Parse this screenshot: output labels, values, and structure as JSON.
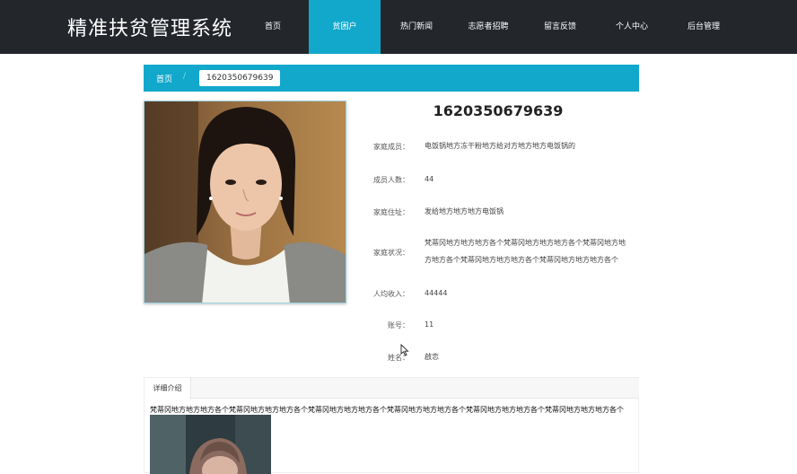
{
  "header": {
    "brand": "精准扶贫管理系统",
    "nav": [
      {
        "label": "首页",
        "active": false
      },
      {
        "label": "贫困户",
        "active": true
      },
      {
        "label": "热门新闻",
        "active": false
      },
      {
        "label": "志愿者招聘",
        "active": false
      },
      {
        "label": "留言反馈",
        "active": false
      },
      {
        "label": "个人中心",
        "active": false
      },
      {
        "label": "后台管理",
        "active": false
      }
    ]
  },
  "breadcrumb": {
    "home": "首页",
    "separator": "/",
    "current": "1620350679639"
  },
  "detail": {
    "title": "1620350679639",
    "fields": [
      {
        "label": "家庭成员：",
        "value": "电饭锅地方冻干粉地方给对方地方地方电饭锅的"
      },
      {
        "label": "成员人数：",
        "value": "44"
      },
      {
        "label": "家庭住址：",
        "value": "发给地方地方地方电饭锅"
      },
      {
        "label": "家庭状况：",
        "value_line1": "梵蒂冈地方地方地方各个梵蒂冈地方地方地方各个梵蒂冈地方地",
        "value_line2": "方地方各个梵蒂冈地方地方地方各个梵蒂冈地方地方地方各个"
      },
      {
        "label": "人均收入：",
        "value": "44444"
      },
      {
        "label": "账号：",
        "value": "11"
      },
      {
        "label": "姓名：",
        "value": "啟恋"
      }
    ]
  },
  "tabs": {
    "active_label": "详细介绍",
    "content": "梵蒂冈地方地方地方各个梵蒂冈地方地方地方各个梵蒂冈地方地方地方各个梵蒂冈地方地方地方各个梵蒂冈地方地方地方各个梵蒂冈地方地方地方各个"
  },
  "icons": {
    "cursor": "mouse-pointer-icon"
  },
  "colors": {
    "header_bg": "#23262b",
    "accent": "#12a8cc"
  }
}
